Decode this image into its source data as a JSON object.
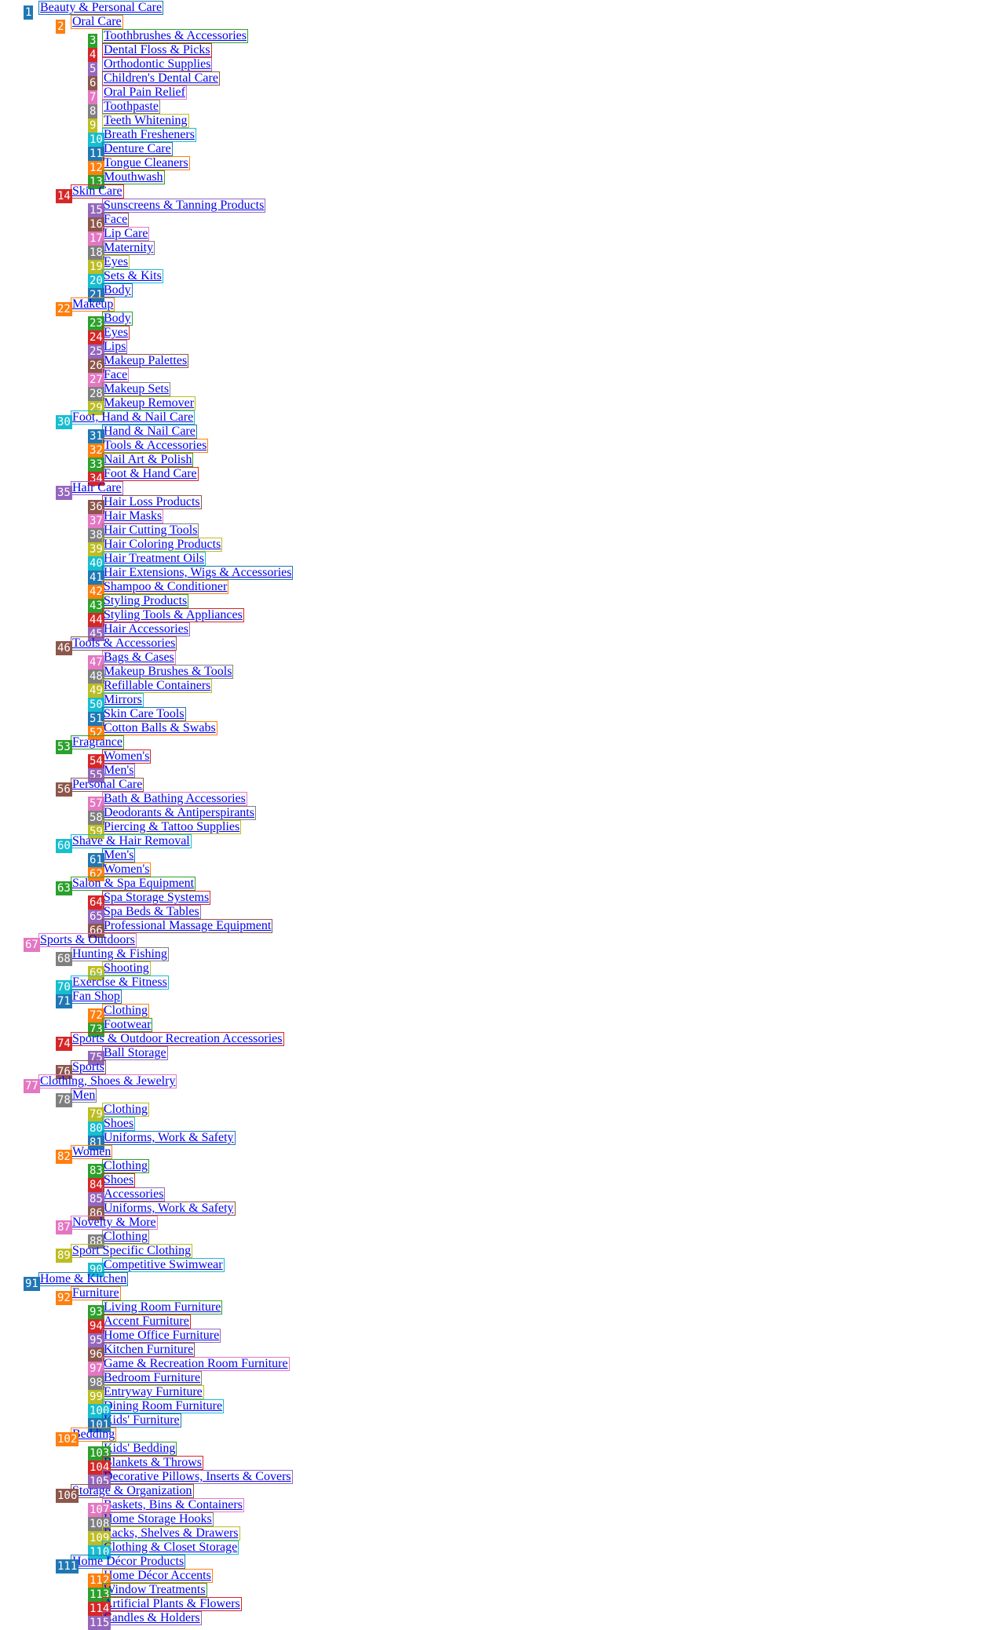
{
  "palette": [
    "#1f77b4",
    "#ff7f0e",
    "#2ca02c",
    "#d62728",
    "#9467bd",
    "#8c564b",
    "#e377c2",
    "#7f7f7f",
    "#bcbd22",
    "#17becf"
  ],
  "tree": [
    {
      "label": "Beauty & Personal Care",
      "children": [
        {
          "label": "Oral Care",
          "children": [
            {
              "label": "Toothbrushes & Accessories"
            },
            {
              "label": "Dental Floss & Picks"
            },
            {
              "label": "Orthodontic Supplies"
            },
            {
              "label": "Children's Dental Care"
            },
            {
              "label": "Oral Pain Relief"
            },
            {
              "label": "Toothpaste"
            },
            {
              "label": "Teeth Whitening"
            },
            {
              "label": "Breath Fresheners"
            },
            {
              "label": "Denture Care"
            },
            {
              "label": "Tongue Cleaners"
            },
            {
              "label": "Mouthwash"
            }
          ]
        },
        {
          "label": "Skin Care",
          "children": [
            {
              "label": "Sunscreens & Tanning Products"
            },
            {
              "label": "Face"
            },
            {
              "label": "Lip Care"
            },
            {
              "label": "Maternity"
            },
            {
              "label": "Eyes"
            },
            {
              "label": "Sets & Kits"
            },
            {
              "label": "Body"
            }
          ]
        },
        {
          "label": "Makeup",
          "children": [
            {
              "label": "Body"
            },
            {
              "label": "Eyes"
            },
            {
              "label": "Lips"
            },
            {
              "label": "Makeup Palettes"
            },
            {
              "label": "Face"
            },
            {
              "label": "Makeup Sets"
            },
            {
              "label": "Makeup Remover"
            }
          ]
        },
        {
          "label": "Foot, Hand & Nail Care",
          "children": [
            {
              "label": "Hand & Nail Care"
            },
            {
              "label": "Tools & Accessories"
            },
            {
              "label": "Nail Art & Polish"
            },
            {
              "label": "Foot & Hand Care"
            }
          ]
        },
        {
          "label": "Hair Care",
          "children": [
            {
              "label": "Hair Loss Products"
            },
            {
              "label": "Hair Masks"
            },
            {
              "label": "Hair Cutting Tools"
            },
            {
              "label": "Hair Coloring Products"
            },
            {
              "label": "Hair Treatment Oils"
            },
            {
              "label": "Hair Extensions, Wigs & Accessories"
            },
            {
              "label": "Shampoo & Conditioner"
            },
            {
              "label": "Styling Products"
            },
            {
              "label": "Styling Tools & Appliances"
            },
            {
              "label": "Hair Accessories"
            }
          ]
        },
        {
          "label": "Tools & Accessories",
          "children": [
            {
              "label": "Bags & Cases"
            },
            {
              "label": "Makeup Brushes & Tools"
            },
            {
              "label": "Refillable Containers"
            },
            {
              "label": "Mirrors"
            },
            {
              "label": "Skin Care Tools"
            },
            {
              "label": "Cotton Balls & Swabs"
            }
          ]
        },
        {
          "label": "Fragrance",
          "children": [
            {
              "label": "Women's"
            },
            {
              "label": "Men's"
            }
          ]
        },
        {
          "label": "Personal Care",
          "children": [
            {
              "label": "Bath & Bathing Accessories"
            },
            {
              "label": "Deodorants & Antiperspirants"
            },
            {
              "label": "Piercing & Tattoo Supplies"
            }
          ]
        },
        {
          "label": "Shave & Hair Removal",
          "children": [
            {
              "label": "Men's"
            },
            {
              "label": "Women's"
            }
          ]
        },
        {
          "label": "Salon & Spa Equipment",
          "children": [
            {
              "label": "Spa Storage Systems"
            },
            {
              "label": "Spa Beds & Tables"
            },
            {
              "label": "Professional Massage Equipment"
            }
          ]
        }
      ]
    },
    {
      "label": "Sports & Outdoors",
      "children": [
        {
          "label": "Hunting & Fishing",
          "children": [
            {
              "label": "Shooting"
            }
          ]
        },
        {
          "label": "Exercise & Fitness",
          "children": []
        },
        {
          "label": "Fan Shop",
          "children": [
            {
              "label": "Clothing"
            },
            {
              "label": "Footwear"
            }
          ]
        },
        {
          "label": "Sports & Outdoor Recreation Accessories",
          "children": [
            {
              "label": "Ball Storage"
            }
          ]
        },
        {
          "label": "Sports",
          "children": []
        }
      ]
    },
    {
      "label": "Clothing, Shoes & Jewelry",
      "children": [
        {
          "label": "Men",
          "children": [
            {
              "label": "Clothing"
            },
            {
              "label": "Shoes"
            },
            {
              "label": "Uniforms, Work & Safety"
            }
          ]
        },
        {
          "label": "Women",
          "children": [
            {
              "label": "Clothing"
            },
            {
              "label": "Shoes"
            },
            {
              "label": "Accessories"
            },
            {
              "label": "Uniforms, Work & Safety"
            }
          ]
        },
        {
          "label": "Novelty & More",
          "children": [
            {
              "label": "Clothing"
            }
          ]
        },
        {
          "label": "Sport Specific Clothing",
          "children": [
            {
              "label": "Competitive Swimwear"
            }
          ]
        }
      ]
    },
    {
      "label": "Home & Kitchen",
      "children": [
        {
          "label": "Furniture",
          "children": [
            {
              "label": "Living Room Furniture"
            },
            {
              "label": "Accent Furniture"
            },
            {
              "label": "Home Office Furniture"
            },
            {
              "label": "Kitchen Furniture"
            },
            {
              "label": "Game & Recreation Room Furniture"
            },
            {
              "label": "Bedroom Furniture"
            },
            {
              "label": "Entryway Furniture"
            },
            {
              "label": "Dining Room Furniture"
            },
            {
              "label": "Kids' Furniture"
            }
          ]
        },
        {
          "label": "Bedding",
          "children": [
            {
              "label": "Kids' Bedding"
            },
            {
              "label": "Blankets & Throws"
            },
            {
              "label": "Decorative Pillows, Inserts & Covers"
            }
          ]
        },
        {
          "label": "Storage & Organization",
          "children": [
            {
              "label": "Baskets, Bins & Containers"
            },
            {
              "label": "Home Storage Hooks"
            },
            {
              "label": "Racks, Shelves & Drawers"
            },
            {
              "label": "Clothing & Closet Storage"
            }
          ]
        },
        {
          "label": "Home Décor Products",
          "children": [
            {
              "label": "Home Décor Accents"
            },
            {
              "label": "Window Treatments"
            },
            {
              "label": "Artificial Plants & Flowers"
            },
            {
              "label": "Candles & Holders"
            }
          ]
        }
      ]
    }
  ]
}
